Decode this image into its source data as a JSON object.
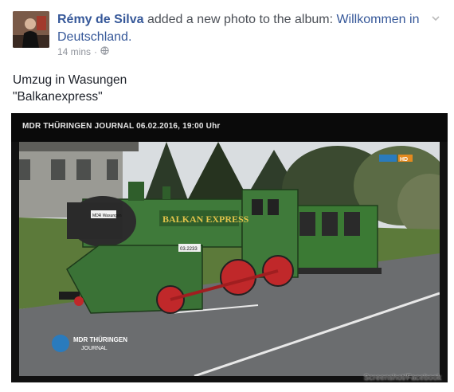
{
  "post": {
    "author": "Rémy de Silva",
    "action": " added a new photo to the album: ",
    "album": "Willkommen in Deutschland.",
    "time": "14 mins",
    "privacy_icon": "globe-icon",
    "menu_icon": "chevron-down-icon"
  },
  "caption": {
    "line1": "Umzug in Wasungen",
    "line2": "\"Balkanexpress\""
  },
  "photo": {
    "tv_banner": "MDR THÜRINGEN JOURNAL 06.02.2016, 19:00 Uhr",
    "locomotive_sign": "BALKAN EXPRESS",
    "small_sign": "MDR Wasungen",
    "number_plate": "03.2233",
    "channel_badge": "HD",
    "logo_line1": "MDR THÜRINGEN",
    "logo_line2": "JOURNAL",
    "credit": "Screenshot/Facebook"
  },
  "colors": {
    "link": "#365899",
    "loco_green": "#3f7a3a",
    "wheel_red": "#c0282a"
  }
}
